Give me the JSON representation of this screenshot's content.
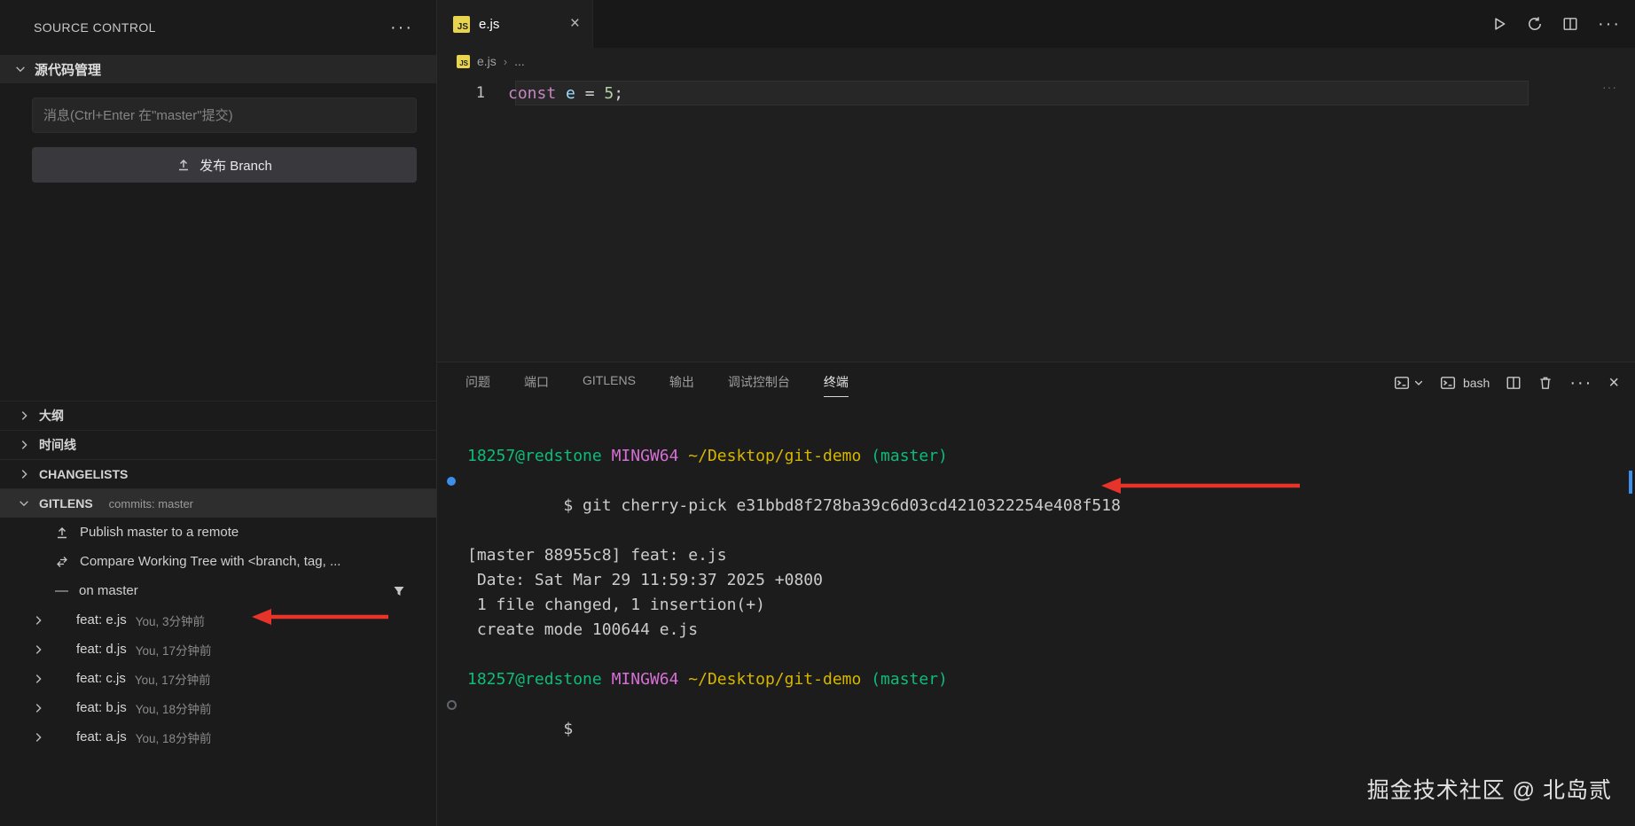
{
  "colors": {
    "accent_blue": "#3b8eea",
    "annotation_red": "#e7342a",
    "terminal_green": "#0dbc79",
    "terminal_magenta": "#d670d6",
    "terminal_yellow": "#d7b600",
    "code_keyword": "#c586c0",
    "code_variable": "#9cdcfe",
    "code_number": "#b5cea8",
    "js_icon_yellow": "#e8d44d"
  },
  "sidebar": {
    "title": "SOURCE CONTROL",
    "title_menu": "···",
    "scm": {
      "header": "源代码管理",
      "message_placeholder": "消息(Ctrl+Enter 在\"master\"提交)",
      "publish_button": "发布 Branch"
    },
    "panels": {
      "outline": "大纲",
      "timeline": "时间线",
      "changelists": "CHANGELISTS",
      "gitlens": "GITLENS",
      "gitlens_detail": "commits: master"
    },
    "gitlens": {
      "actions": [
        {
          "label": "Publish master to a remote"
        },
        {
          "label": "Compare Working Tree with <branch, tag, ..."
        },
        {
          "label": "on master"
        }
      ],
      "commits": [
        {
          "label": "feat: e.js",
          "meta": "You, 3分钟前"
        },
        {
          "label": "feat: d.js",
          "meta": "You, 17分钟前"
        },
        {
          "label": "feat: c.js",
          "meta": "You, 17分钟前"
        },
        {
          "label": "feat: b.js",
          "meta": "You, 18分钟前"
        },
        {
          "label": "feat: a.js",
          "meta": "You, 18分钟前"
        }
      ]
    }
  },
  "editor": {
    "tab_label": "e.js",
    "breadcrumb_file": "e.js",
    "breadcrumb_more": "...",
    "line_number": "1",
    "code_tokens": {
      "keyword": "const",
      "variable": " e ",
      "operator": "= ",
      "number": "5",
      "semicolon": ";"
    },
    "minimap_marks": "···"
  },
  "panel": {
    "tabs": [
      "问题",
      "端口",
      "GITLENS",
      "输出",
      "调试控制台",
      "终端"
    ],
    "active_tab": "终端",
    "shell_name": "bash",
    "terminal": {
      "prompt": {
        "user": "18257@redstone",
        "env": "MINGW64",
        "path": "~/Desktop/git-demo",
        "branch": "(master)"
      },
      "command": "$ git cherry-pick e31bbd8f278ba39c6d03cd4210322254e408f518",
      "output": [
        "[master 88955c8] feat: e.js",
        " Date: Sat Mar 29 11:59:37 2025 +0800",
        " 1 file changed, 1 insertion(+)",
        " create mode 100644 e.js"
      ],
      "prompt2_cursor": "$"
    }
  },
  "watermark": "掘金技术社区 @ 北岛贰"
}
